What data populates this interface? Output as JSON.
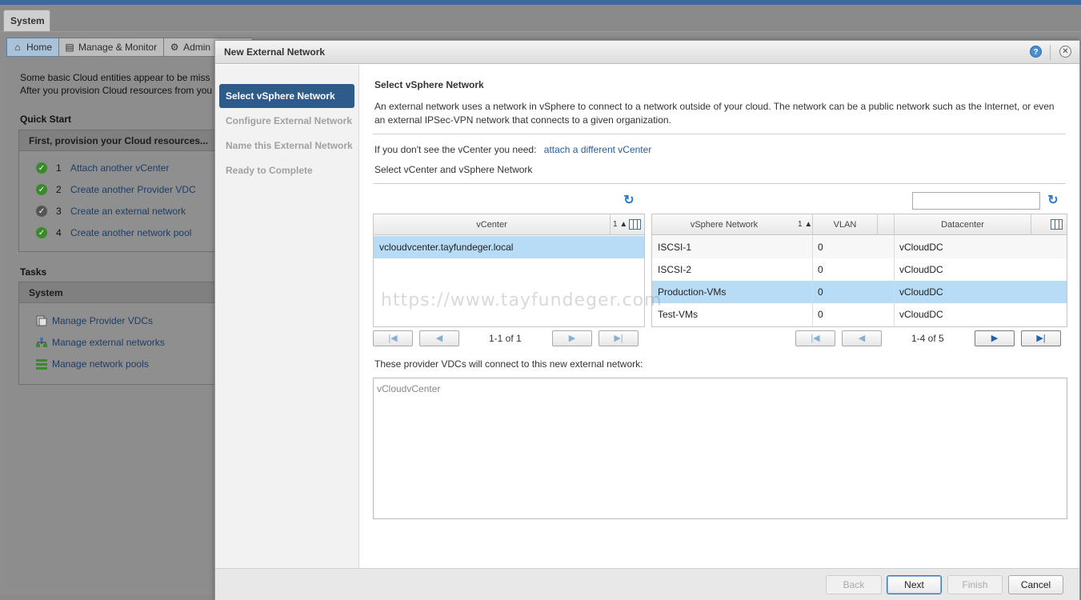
{
  "app": {
    "system_tab": "System",
    "subtabs": [
      {
        "label": "Home",
        "icon": "home-icon"
      },
      {
        "label": "Manage & Monitor",
        "icon": "monitor-icon"
      },
      {
        "label": "Admin",
        "icon": "admin-icon"
      }
    ]
  },
  "home": {
    "intro_line1": "Some basic Cloud entities appear to be miss",
    "intro_line2": "After you provision Cloud resources from you",
    "quick_start_title": "Quick Start",
    "quick_start_header": "First, provision your Cloud resources...",
    "quick_start_items": [
      {
        "num": "1",
        "label": "Attach another vCenter",
        "done": true
      },
      {
        "num": "2",
        "label": "Create another Provider VDC",
        "done": true
      },
      {
        "num": "3",
        "label": "Create an external network",
        "done": false
      },
      {
        "num": "4",
        "label": "Create another network pool",
        "done": true
      }
    ],
    "tasks_title": "Tasks",
    "tasks_header": "System",
    "tasks": [
      {
        "label": "Manage Provider VDCs",
        "icon": "provider-vdc-icon"
      },
      {
        "label": "Manage external networks",
        "icon": "external-network-icon"
      },
      {
        "label": "Manage network pools",
        "icon": "network-pool-icon"
      }
    ]
  },
  "dialog": {
    "title": "New External Network",
    "steps": [
      "Select vSphere Network",
      "Configure External Network",
      "Name this External Network",
      "Ready to Complete"
    ],
    "active_step": 0,
    "heading": "Select vSphere Network",
    "description": "An external network uses a network in vSphere to connect to a network outside of your cloud. The network can be a public network such as the Internet, or even an external IPSec-VPN network that connects to a given organization.",
    "vcenter_prompt": "If you don't see the vCenter you need:",
    "vcenter_link": "attach a different vCenter",
    "select_label": "Select vCenter and vSphere Network",
    "search_value": "",
    "vcenter_grid": {
      "column": "vCenter",
      "sort": "1 ▲",
      "rows": [
        "vcloudvcenter.tayfundeger.local"
      ],
      "pager": "1-1 of 1"
    },
    "network_grid": {
      "columns": [
        "vSphere Network",
        "VLAN",
        "Datacenter"
      ],
      "sort": "1 ▲",
      "rows": [
        {
          "network": "ISCSI-1",
          "vlan": "0",
          "datacenter": "vCloudDC"
        },
        {
          "network": "ISCSI-2",
          "vlan": "0",
          "datacenter": "vCloudDC"
        },
        {
          "network": "Production-VMs",
          "vlan": "0",
          "datacenter": "vCloudDC"
        },
        {
          "network": "Test-VMs",
          "vlan": "0",
          "datacenter": "vCloudDC"
        }
      ],
      "selected_row": 2,
      "pager": "1-4 of 5"
    },
    "pvdc_label": "These provider VDCs will connect to this new external network:",
    "pvdc_items": [
      "vCloudvCenter"
    ],
    "buttons": {
      "back": "Back",
      "next": "Next",
      "finish": "Finish",
      "cancel": "Cancel"
    }
  },
  "watermark": "https://www.tayfundeger.com"
}
